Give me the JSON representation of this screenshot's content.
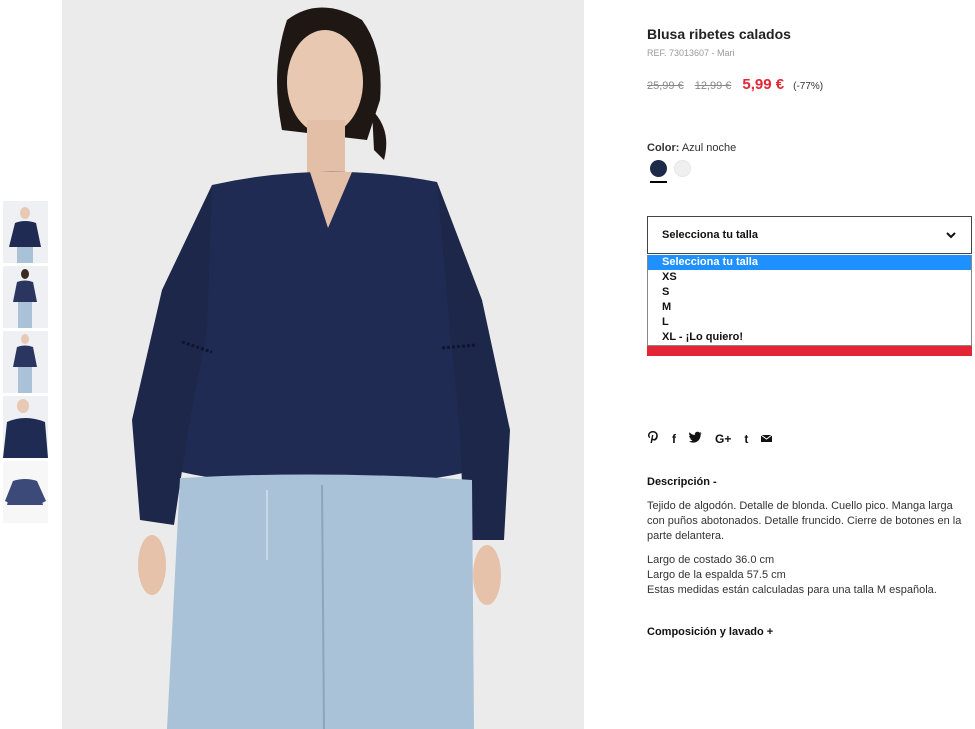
{
  "product": {
    "title": "Blusa ribetes calados",
    "ref": "REF. 73013607 - Mari",
    "prices": {
      "original": "25,99 €",
      "previous": "12,99 €",
      "current": "5,99 €",
      "discount": "(-77%)"
    }
  },
  "color": {
    "label": "Color:",
    "value": "Azul noche",
    "swatches": [
      "navy",
      "white"
    ],
    "swatch_colors": [
      "#1d2a48",
      "#f0f0f0"
    ]
  },
  "size": {
    "select_label": "Selecciona tu talla",
    "options": [
      "Selecciona tu talla",
      "XS",
      "S",
      "M",
      "L",
      "XL - ¡Lo quiero!"
    ]
  },
  "share": {
    "icons": [
      "pinterest-icon",
      "facebook-icon",
      "twitter-icon",
      "google-plus-icon",
      "tumblr-icon",
      "email-icon"
    ],
    "glyphs": [
      "℗",
      "f",
      "🐦",
      "G+",
      "t",
      "✉"
    ]
  },
  "description": {
    "heading": "Descripción -",
    "text": "Tejido de algodón. Detalle de blonda. Cuello pico. Manga larga con puños abotonados. Detalle fruncido. Cierre de botones en la parte delantera.",
    "measures": [
      "Largo de costado 36.0 cm",
      "Largo de la espalda 57.5 cm",
      "Estas medidas están calculadas para una talla M española."
    ]
  },
  "composition": {
    "heading": "Composición y lavado +"
  },
  "colors": {
    "accent_red": "#e22635",
    "selected_blue": "#1e90ff",
    "blouse_navy": "#1f2b52",
    "jeans": "#a9c2d8"
  }
}
